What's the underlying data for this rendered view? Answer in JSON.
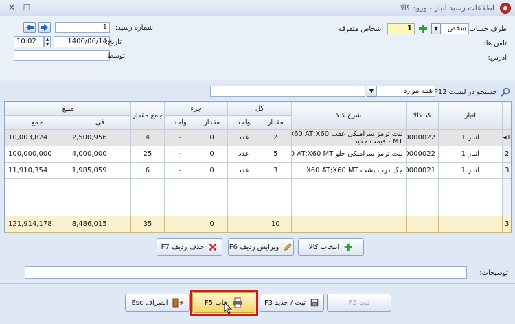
{
  "window": {
    "title": "اطلاعات رسید انبار - ورود کالا",
    "controls": {
      "minimize": "—",
      "maximize": "☐",
      "close": "✕"
    }
  },
  "header": {
    "receipt_number_label": "شماره رسید:",
    "receipt_number": "1",
    "date_label": "تاریخ:",
    "date": "1400/06/14",
    "time": "10:02",
    "by_label": "توسط:",
    "by_value": "",
    "account_party_label": "طرف حساب:",
    "party_type": "شخص",
    "party_code": "1",
    "party_name": "اشخاص متفرقه",
    "phones_label": "تلفن ها:",
    "address_label": "آدرس:"
  },
  "search": {
    "label": "جستجو در لیست F12",
    "filter_value": "همه موارد",
    "query": ""
  },
  "grid": {
    "headers": {
      "anbar": "انبار",
      "code": "کد کالا",
      "desc": "شرح کالا",
      "kol": "کل",
      "joz": "جزء",
      "total_qty": "جمع مقدار",
      "amount": "مبلغ",
      "qty": "مقدار",
      "unit": "واحد",
      "fee": "فی",
      "sum": "جمع"
    },
    "rows": [
      {
        "rn": "1",
        "anbar": "انبار 1",
        "code": "900000022",
        "desc1": "لنت ترمز سرامیکی عقب X60 AT;X60",
        "desc2": "MT - قیمت جدید",
        "kol_qty": "2",
        "kol_unit": "عدد",
        "joz_qty": "0",
        "joz_unit": "-",
        "total_qty": "4",
        "fee": "2,500,956",
        "sum": "10,003,824"
      },
      {
        "rn": "2",
        "anbar": "انبار 1",
        "code": "900000022",
        "desc1": "لنت ترمز سرامیکی جلو X60 AT;X60 MT",
        "desc2": "",
        "kol_qty": "5",
        "kol_unit": "عدد",
        "joz_qty": "0",
        "joz_unit": "-",
        "total_qty": "25",
        "fee": "4,000,000",
        "sum": "100,000,000"
      },
      {
        "rn": "3",
        "anbar": "انبار 1",
        "code": "900000021",
        "desc1": "جک درب پشت X60 AT;X60 MT",
        "desc2": "",
        "kol_qty": "3",
        "kol_unit": "عدد",
        "joz_qty": "0",
        "joz_unit": "-",
        "total_qty": "6",
        "fee": "1,985,059",
        "sum": "11,910,354"
      }
    ],
    "footer": {
      "rn": "3",
      "kol_qty": "10",
      "joz_qty": "0",
      "total_qty": "35",
      "fee": "8,486,015",
      "sum": "121,914,178"
    }
  },
  "row_actions": {
    "select_item": "انتخاب کالا",
    "edit_row": "ویرایش ردیف F6",
    "delete_row": "حذف ردیف F7"
  },
  "notes": {
    "label": "توضیحات:",
    "value": ""
  },
  "footer_buttons": {
    "save": "ثبت F2",
    "save_new": "ثبت / جدید F3",
    "print": "چاپ F5",
    "cancel": "انصراف Esc"
  },
  "colors": {
    "highlight_box": "#d11a1a",
    "print_button": "#f6d46a",
    "add_icon": "#2e9e35",
    "delete_icon": "#d12a2a"
  }
}
